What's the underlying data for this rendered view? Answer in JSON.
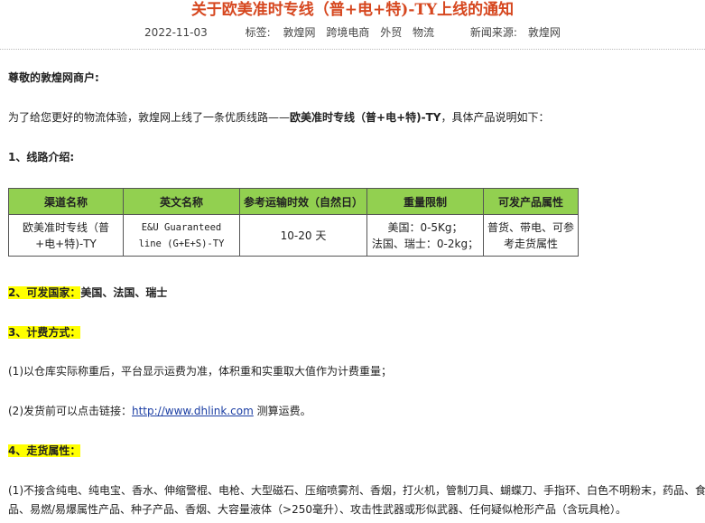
{
  "title": "关于欧美准时专线（普+电+特)-TY上线的通知",
  "meta": {
    "date": "2022-11-03",
    "tags_label": "标签:",
    "tags": [
      "敦煌网",
      "跨境电商",
      "外贸",
      "物流"
    ],
    "source_label": "新闻来源:",
    "source": "敦煌网"
  },
  "greeting": "尊敬的敦煌网商户:",
  "intro": {
    "prefix": "为了给您更好的物流体验，敦煌网上线了一条优质线路——",
    "highlight": "欧美准时专线（普+电+特)-TY",
    "suffix": "，具体产品说明如下："
  },
  "section1": "1、线路介绍:",
  "table": {
    "headers": [
      "渠道名称",
      "英文名称",
      "参考运输时效（自然日）",
      "重量限制",
      "可发产品属性"
    ],
    "row": {
      "channel": "欧美准时专线（普+电+特)-TY",
      "english": "E&U Guaranteed line (G+E+S)-TY",
      "time": "10-20 天",
      "weight_line1": "美国：0-5Kg；",
      "weight_line2": "法国、瑞士：0-2kg；",
      "attributes": "普货、带电、可参考走货属性"
    }
  },
  "section2": {
    "label": "2、可发国家：",
    "countries": "美国、法国、瑞士"
  },
  "section3": "3、计费方式：",
  "billing1": "(1)以仓库实际称重后，平台显示运费为准，体积重和实重取大值作为计费重量；",
  "billing2": {
    "prefix": "(2)发货前可以点击链接：",
    "link": "http://www.dhlink.com",
    "suffix": " 测算运费。"
  },
  "section4": "4、走货属性：",
  "cargo1": "(1)不接含纯电、纯电宝、香水、伸缩警棍、电枪、大型磁石、压缩喷雾剂、香烟，打火机，管制刀具、蝴蝶刀、手指环、白色不明粉末，药品、食",
  "cargo2": "品、易燃/易爆属性产品、种子产品、香烟、大容量液体（>250毫升）、攻击性武器或形似武器、任何疑似枪形产品（含玩具枪）。"
}
